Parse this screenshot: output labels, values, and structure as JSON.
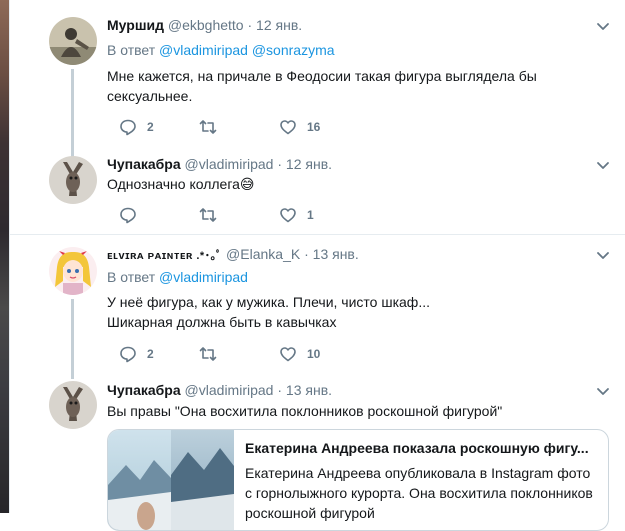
{
  "tweets": [
    {
      "name": "Муршид",
      "handle": "@ekbghetto",
      "dot": "·",
      "date": "12 янв.",
      "reply_prefix": "В ответ",
      "reply_to": [
        "@vladimiripad",
        "@sonrazyma"
      ],
      "text": "Мне кажется, на причале в Феодосии такая фигура выглядела бы сексуальнее.",
      "replies": "2",
      "retweets": "",
      "likes": "16"
    },
    {
      "name": "Чупакабра",
      "handle": "@vladimiripad",
      "dot": "·",
      "date": "12 янв.",
      "text": "Однозначно коллега😅",
      "replies": "",
      "retweets": "",
      "likes": "1"
    },
    {
      "name": "ᴇʟᴠɪʀᴀ ᴘᴀɪɴᴛᴇʀ .*･｡ﾟ",
      "handle": "@Elanka_K",
      "dot": "·",
      "date": "13 янв.",
      "reply_prefix": "В ответ",
      "reply_to": [
        "@vladimiripad"
      ],
      "text_lines": [
        "У неё фигура, как у мужика. Плечи, чисто шкаф...",
        "Шикарная должна быть в кавычках"
      ],
      "replies": "2",
      "retweets": "",
      "likes": "10"
    },
    {
      "name": "Чупакабра",
      "handle": "@vladimiripad",
      "dot": "·",
      "date": "13 янв.",
      "text": "Вы правы \"Она восхитила поклонников роскошной фигурой\"",
      "card": {
        "title": "Екатерина Андреева показала роскошную фигу...",
        "description": "Екатерина Андреева опубликовала в Instagram фото с горнолыжного курорта. Она восхитила поклонников роскошной фигурой"
      }
    }
  ],
  "icons": {
    "reply": "reply-icon",
    "retweet": "retweet-icon",
    "like": "heart-icon",
    "more": "chevron-down-icon"
  },
  "colors": {
    "link": "#1b95e0",
    "secondary": "#657786",
    "thread_line": "#c4cfd6",
    "divider": "#e6ecf0"
  }
}
